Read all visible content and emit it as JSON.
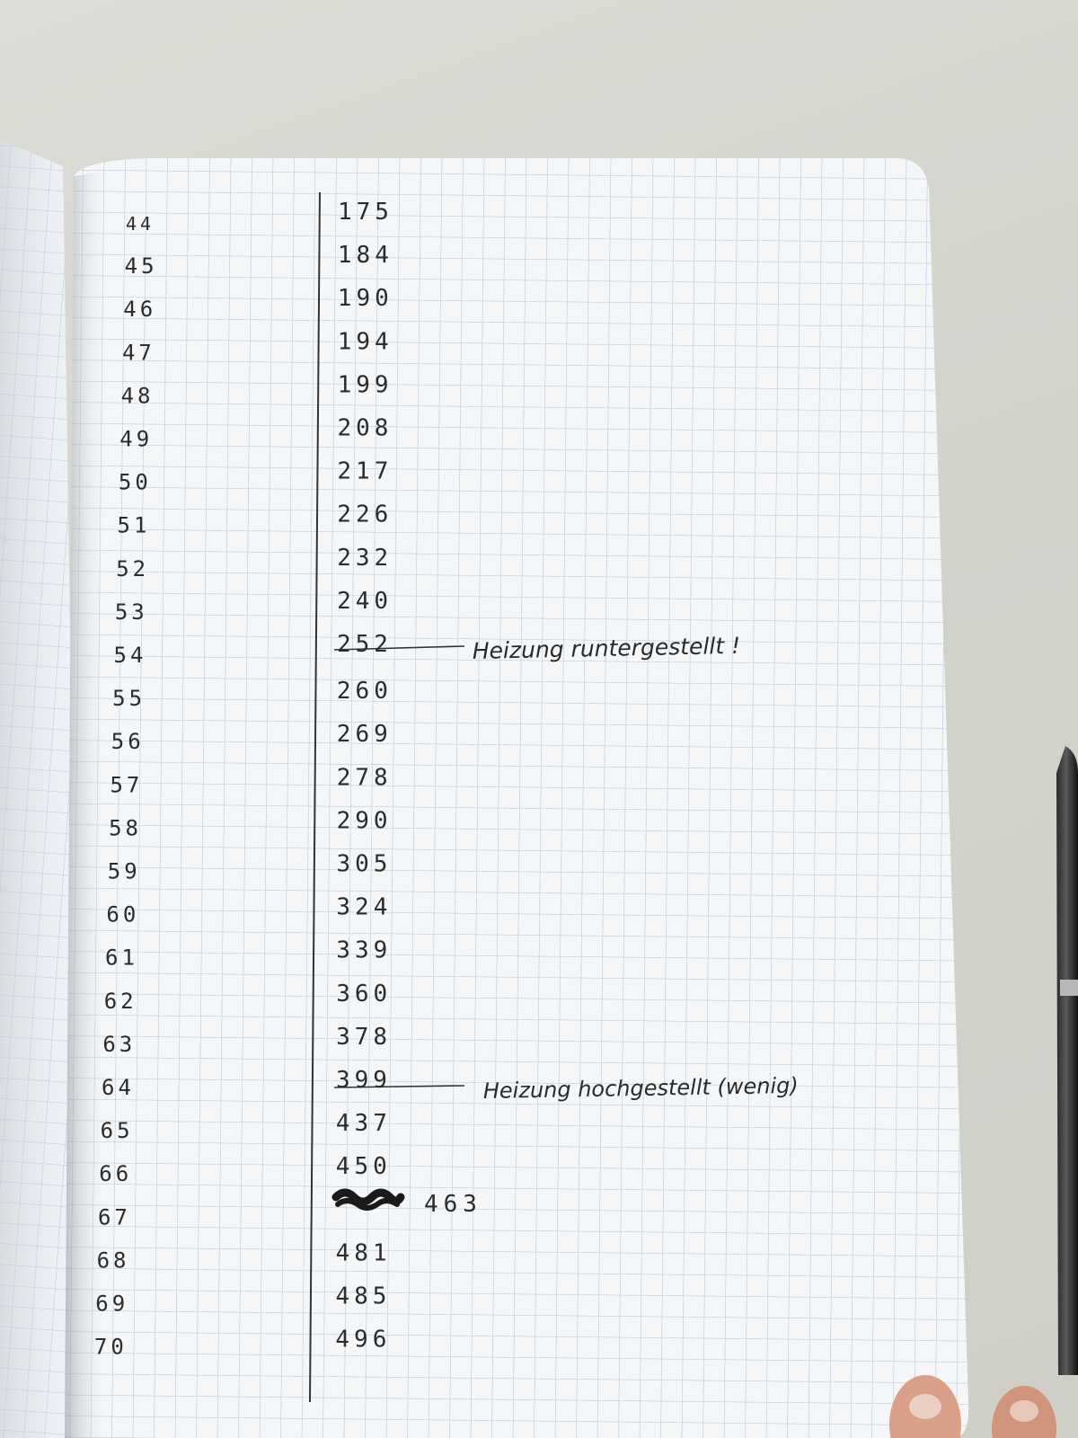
{
  "notebook": {
    "left_column": [
      "44",
      "45",
      "46",
      "47",
      "48",
      "49",
      "50",
      "51",
      "52",
      "53",
      "54",
      "55",
      "56",
      "57",
      "58",
      "59",
      "60",
      "61",
      "62",
      "63",
      "64",
      "65",
      "66",
      "67",
      "68",
      "69",
      "70"
    ],
    "right_column": [
      "175",
      "184",
      "190",
      "194",
      "199",
      "208",
      "217",
      "226",
      "232",
      "240",
      "252",
      "260",
      "269",
      "278",
      "290",
      "305",
      "324",
      "339",
      "360",
      "378",
      "399",
      "437",
      "450",
      "",
      "481",
      "485",
      "496"
    ],
    "correction_value": "463",
    "annotation_1": "Heizung runtergestellt !",
    "annotation_2": "Heizung hochgestellt (wenig)"
  },
  "colors": {
    "paper": "#f4f6f8",
    "grid": "#a9c6dc",
    "ink": "#2b2b2b",
    "desk": "#d6d6cf"
  }
}
